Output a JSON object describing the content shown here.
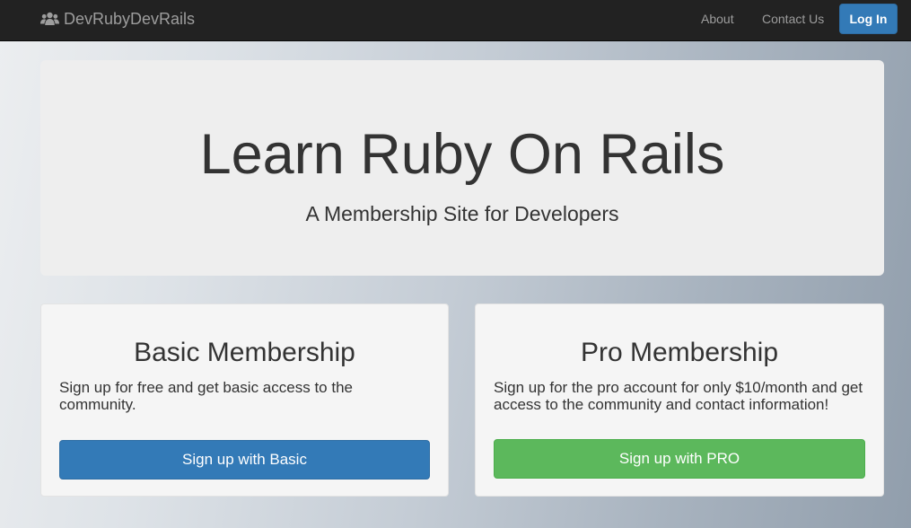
{
  "navbar": {
    "brand": "DevRubyDevRails",
    "brand_icon": "users-icon",
    "links": [
      "About",
      "Contact Us"
    ],
    "login_label": "Log In"
  },
  "jumbotron": {
    "title": "Learn Ruby On Rails",
    "subtitle": "A Membership Site for Developers"
  },
  "plans": {
    "basic": {
      "title": "Basic Membership",
      "description": "Sign up for free and get basic access to the community.",
      "button": "Sign up with Basic"
    },
    "pro": {
      "title": "Pro Membership",
      "description": "Sign up for the pro account for only $10/month and get access to the community and contact information!",
      "button": "Sign up with PRO"
    }
  },
  "colors": {
    "navbar_bg": "#222222",
    "primary": "#337ab7",
    "success": "#5cb85c",
    "text": "#333333"
  }
}
